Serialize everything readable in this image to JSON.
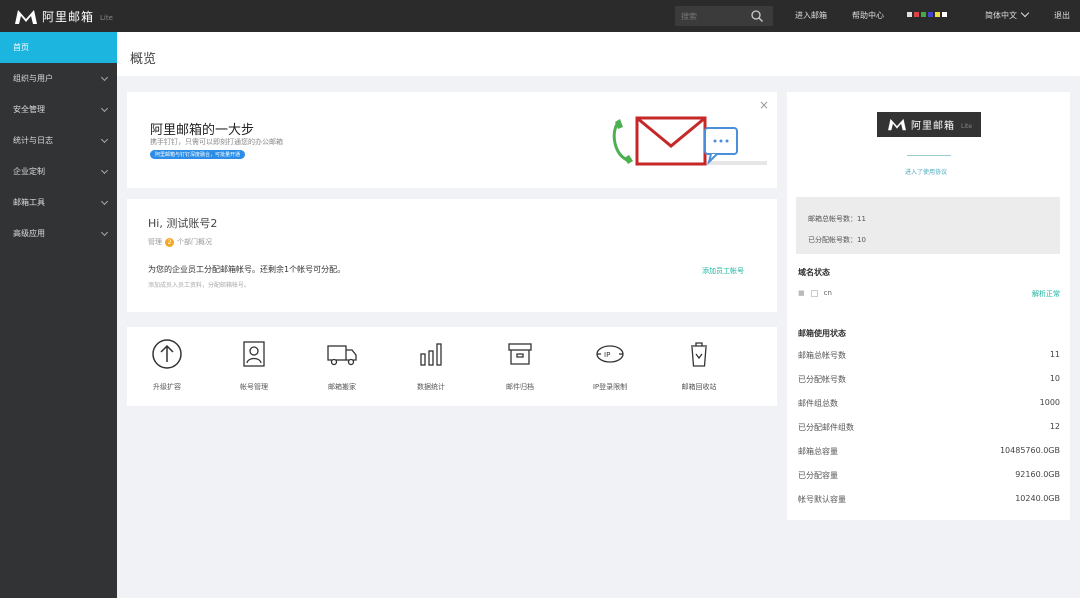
{
  "topbar": {
    "logo_text": "阿里邮箱",
    "logo_sub": "Lite",
    "search_placeholder": "搜索",
    "links": [
      "进入邮箱",
      "帮助中心"
    ],
    "language": "简体中文",
    "logout": "退出",
    "account_colors": [
      "#e0e0e0",
      "#d44",
      "#4a4",
      "#44c",
      "#f0e040",
      "#fff"
    ]
  },
  "sidebar": {
    "items": [
      {
        "label": "首页",
        "active": true
      },
      {
        "label": "组织与用户",
        "chevron": true
      },
      {
        "label": "安全管理",
        "chevron": true
      },
      {
        "label": "统计与日志",
        "chevron": true
      },
      {
        "label": "企业定制",
        "chevron": true
      },
      {
        "label": "邮箱工具",
        "chevron": true
      },
      {
        "label": "高级应用",
        "chevron": true
      }
    ]
  },
  "page": {
    "title": "概览"
  },
  "banner": {
    "title": "阿里邮箱的一大步",
    "desc": "携手钉钉，只需可以即刻打通您的办公邮箱",
    "badge": "阿里邮箱与钉钉深度融合，可批量开通",
    "close": "×"
  },
  "welcome": {
    "hi": "Hi, 测试账号2",
    "role": "管理",
    "role_count": "2",
    "role_suffix": "个部门概况",
    "alloc": "为您的企业员工分配邮箱帐号。还剩余1个帐号可分配。",
    "hint": "添加成员入员工资料，分配邮箱帐号。",
    "link": "添加员工帐号"
  },
  "actions": [
    {
      "label": "升级扩容",
      "icon": "upgrade-icon"
    },
    {
      "label": "帐号管理",
      "icon": "account-icon"
    },
    {
      "label": "邮箱搬家",
      "icon": "truck-icon"
    },
    {
      "label": "数据统计",
      "icon": "stats-icon"
    },
    {
      "label": "邮件归档",
      "icon": "archive-icon"
    },
    {
      "label": "IP登录限制",
      "icon": "ip-icon"
    },
    {
      "label": "邮箱回收站",
      "icon": "trash-icon"
    }
  ],
  "right": {
    "logo_text": "阿里邮箱",
    "logo_sub": "Lite",
    "sub_link": "进入了使用协议",
    "stats": [
      {
        "label": "邮箱总帐号数：",
        "value": "11"
      },
      {
        "label": "已分配帐号数：",
        "value": "10"
      }
    ],
    "domain_title": "域名状态",
    "domain_name": "cn",
    "domain_status": "解析正常",
    "usage_title": "邮箱使用状态",
    "usage": [
      {
        "label": "邮箱总帐号数",
        "value": "11"
      },
      {
        "label": "已分配帐号数",
        "value": "10"
      },
      {
        "label": "邮件组总数",
        "value": "1000"
      },
      {
        "label": "已分配邮件组数",
        "value": "12"
      },
      {
        "label": "邮箱总容量",
        "value": "10485760.0GB"
      },
      {
        "label": "已分配容量",
        "value": "92160.0GB"
      },
      {
        "label": "帐号默认容量",
        "value": "10240.0GB"
      }
    ]
  }
}
